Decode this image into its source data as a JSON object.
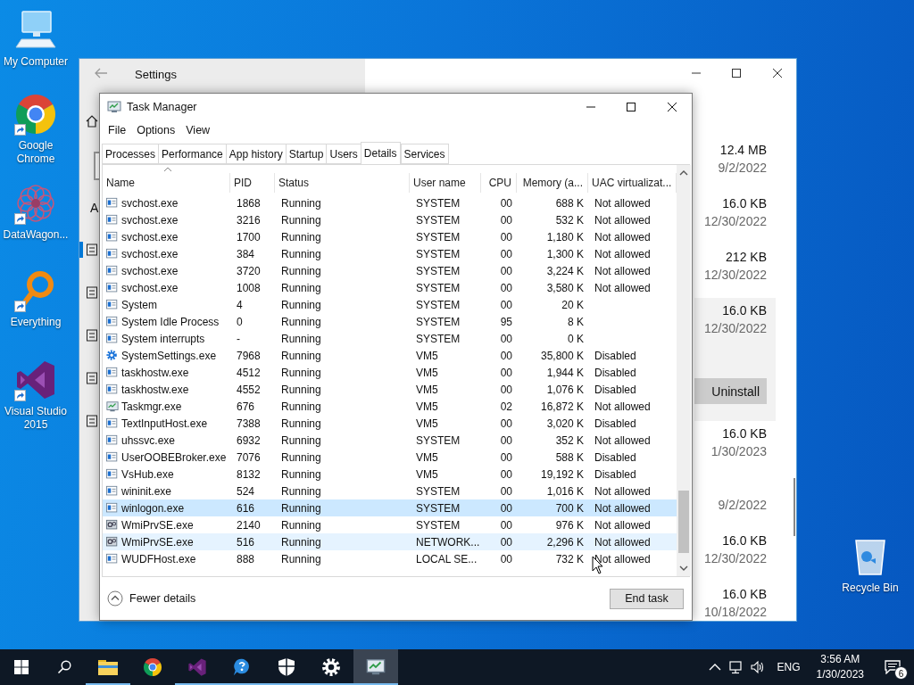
{
  "desktop_icons": [
    {
      "label": "My Computer",
      "kind": "computer",
      "shortcut": false
    },
    {
      "label": "Google Chrome",
      "kind": "chrome",
      "shortcut": true
    },
    {
      "label": "DataWagon...",
      "kind": "mandala",
      "shortcut": true
    },
    {
      "label": "Everything",
      "kind": "magnifier",
      "shortcut": true
    },
    {
      "label": "Visual Studio 2015",
      "kind": "vs",
      "shortcut": true
    },
    {
      "label": "Recycle Bin",
      "kind": "recycle",
      "shortcut": false
    }
  ],
  "settings": {
    "title": "Settings",
    "heading_fragment": "A",
    "nav_items": [
      {
        "selected": true
      },
      {
        "selected": false
      },
      {
        "selected": false
      },
      {
        "selected": false
      },
      {
        "selected": false
      }
    ],
    "apps": [
      {
        "size": "12.4 MB",
        "date": "9/2/2022",
        "selected": false
      },
      {
        "size": "16.0 KB",
        "date": "12/30/2022",
        "selected": false
      },
      {
        "size": "212 KB",
        "date": "12/30/2022",
        "selected": false
      },
      {
        "size": "16.0 KB",
        "date": "12/30/2022",
        "selected": true,
        "button": "Uninstall"
      },
      {
        "size": "16.0 KB",
        "date": "1/30/2023",
        "selected": false
      },
      {
        "date": "9/2/2022",
        "selected": false
      },
      {
        "size": "16.0 KB",
        "date": "12/30/2022",
        "selected": false
      },
      {
        "size": "16.0 KB",
        "date": "10/18/2022",
        "selected": false
      }
    ]
  },
  "task_manager": {
    "title": "Task Manager",
    "menu": [
      "File",
      "Options",
      "View"
    ],
    "tabs": [
      {
        "label": "Processes",
        "selected": false
      },
      {
        "label": "Performance",
        "selected": false
      },
      {
        "label": "App history",
        "selected": false
      },
      {
        "label": "Startup",
        "selected": false
      },
      {
        "label": "Users",
        "selected": false
      },
      {
        "label": "Details",
        "selected": true
      },
      {
        "label": "Services",
        "selected": false
      }
    ],
    "columns": [
      "Name",
      "PID",
      "Status",
      "User name",
      "CPU",
      "Memory (a...",
      "UAC virtualizat..."
    ],
    "rows": [
      {
        "kind": "exe",
        "name": "svchost.exe",
        "pid": "1868",
        "status": "Running",
        "user": "SYSTEM",
        "cpu": "00",
        "memory": "688 K",
        "uac": "Not allowed",
        "selected": false,
        "hovered": false
      },
      {
        "kind": "exe",
        "name": "svchost.exe",
        "pid": "3216",
        "status": "Running",
        "user": "SYSTEM",
        "cpu": "00",
        "memory": "532 K",
        "uac": "Not allowed",
        "selected": false,
        "hovered": false
      },
      {
        "kind": "exe",
        "name": "svchost.exe",
        "pid": "1700",
        "status": "Running",
        "user": "SYSTEM",
        "cpu": "00",
        "memory": "1,180 K",
        "uac": "Not allowed",
        "selected": false,
        "hovered": false
      },
      {
        "kind": "exe",
        "name": "svchost.exe",
        "pid": "384",
        "status": "Running",
        "user": "SYSTEM",
        "cpu": "00",
        "memory": "1,300 K",
        "uac": "Not allowed",
        "selected": false,
        "hovered": false
      },
      {
        "kind": "exe",
        "name": "svchost.exe",
        "pid": "3720",
        "status": "Running",
        "user": "SYSTEM",
        "cpu": "00",
        "memory": "3,224 K",
        "uac": "Not allowed",
        "selected": false,
        "hovered": false
      },
      {
        "kind": "exe",
        "name": "svchost.exe",
        "pid": "1008",
        "status": "Running",
        "user": "SYSTEM",
        "cpu": "00",
        "memory": "3,580 K",
        "uac": "Not allowed",
        "selected": false,
        "hovered": false
      },
      {
        "kind": "exe",
        "name": "System",
        "pid": "4",
        "status": "Running",
        "user": "SYSTEM",
        "cpu": "00",
        "memory": "20 K",
        "selected": false,
        "hovered": false
      },
      {
        "kind": "exe",
        "name": "System Idle Process",
        "pid": "0",
        "status": "Running",
        "user": "SYSTEM",
        "cpu": "95",
        "memory": "8 K",
        "selected": false,
        "hovered": false
      },
      {
        "kind": "exe",
        "name": "System interrupts",
        "pid": "-",
        "status": "Running",
        "user": "SYSTEM",
        "cpu": "00",
        "memory": "0 K",
        "selected": false,
        "hovered": false
      },
      {
        "kind": "gear",
        "name": "SystemSettings.exe",
        "pid": "7968",
        "status": "Running",
        "user": "VM5",
        "cpu": "00",
        "memory": "35,800 K",
        "uac": "Disabled",
        "selected": false,
        "hovered": false
      },
      {
        "kind": "exe",
        "name": "taskhostw.exe",
        "pid": "4512",
        "status": "Running",
        "user": "VM5",
        "cpu": "00",
        "memory": "1,944 K",
        "uac": "Disabled",
        "selected": false,
        "hovered": false
      },
      {
        "kind": "exe",
        "name": "taskhostw.exe",
        "pid": "4552",
        "status": "Running",
        "user": "VM5",
        "cpu": "00",
        "memory": "1,076 K",
        "uac": "Disabled",
        "selected": false,
        "hovered": false
      },
      {
        "kind": "taskmgr",
        "name": "Taskmgr.exe",
        "pid": "676",
        "status": "Running",
        "user": "VM5",
        "cpu": "02",
        "memory": "16,872 K",
        "uac": "Not allowed",
        "selected": false,
        "hovered": false
      },
      {
        "kind": "exe",
        "name": "TextInputHost.exe",
        "pid": "7388",
        "status": "Running",
        "user": "VM5",
        "cpu": "00",
        "memory": "3,020 K",
        "uac": "Disabled",
        "selected": false,
        "hovered": false
      },
      {
        "kind": "exe",
        "name": "uhssvc.exe",
        "pid": "6932",
        "status": "Running",
        "user": "SYSTEM",
        "cpu": "00",
        "memory": "352 K",
        "uac": "Not allowed",
        "selected": false,
        "hovered": false
      },
      {
        "kind": "exe",
        "name": "UserOOBEBroker.exe",
        "pid": "7076",
        "status": "Running",
        "user": "VM5",
        "cpu": "00",
        "memory": "588 K",
        "uac": "Disabled",
        "selected": false,
        "hovered": false
      },
      {
        "kind": "exe",
        "name": "VsHub.exe",
        "pid": "8132",
        "status": "Running",
        "user": "VM5",
        "cpu": "00",
        "memory": "19,192 K",
        "uac": "Disabled",
        "selected": false,
        "hovered": false
      },
      {
        "kind": "exe",
        "name": "wininit.exe",
        "pid": "524",
        "status": "Running",
        "user": "SYSTEM",
        "cpu": "00",
        "memory": "1,016 K",
        "uac": "Not allowed",
        "selected": false,
        "hovered": false
      },
      {
        "kind": "exe",
        "name": "winlogon.exe",
        "pid": "616",
        "status": "Running",
        "user": "SYSTEM",
        "cpu": "00",
        "memory": "700 K",
        "uac": "Not allowed",
        "selected": true,
        "hovered": false
      },
      {
        "kind": "wmi",
        "name": "WmiPrvSE.exe",
        "pid": "2140",
        "status": "Running",
        "user": "SYSTEM",
        "cpu": "00",
        "memory": "976 K",
        "uac": "Not allowed",
        "selected": false,
        "hovered": false
      },
      {
        "kind": "wmi",
        "name": "WmiPrvSE.exe",
        "pid": "516",
        "status": "Running",
        "user": "NETWORK...",
        "cpu": "00",
        "memory": "2,296 K",
        "uac": "Not allowed",
        "selected": false,
        "hovered": true
      },
      {
        "kind": "exe",
        "name": "WUDFHost.exe",
        "pid": "888",
        "status": "Running",
        "user": "LOCAL SE...",
        "cpu": "00",
        "memory": "732 K",
        "uac": "Not allowed",
        "selected": false,
        "hovered": false
      }
    ],
    "footer": {
      "toggle": "Fewer details",
      "button": "End task"
    }
  },
  "taskbar": {
    "apps": [
      {
        "kind": "folder",
        "running": true,
        "active": false
      },
      {
        "kind": "chrome",
        "running": false,
        "active": false
      },
      {
        "kind": "vs",
        "running": true,
        "active": false
      },
      {
        "kind": "help",
        "running": true,
        "active": false
      },
      {
        "kind": "shield",
        "running": true,
        "active": false
      },
      {
        "kind": "gear",
        "running": true,
        "active": false
      },
      {
        "kind": "taskmgr",
        "running": true,
        "active": true
      }
    ],
    "language": "ENG",
    "time": "3:56 AM",
    "date": "1/30/2023",
    "notifications": "6"
  }
}
